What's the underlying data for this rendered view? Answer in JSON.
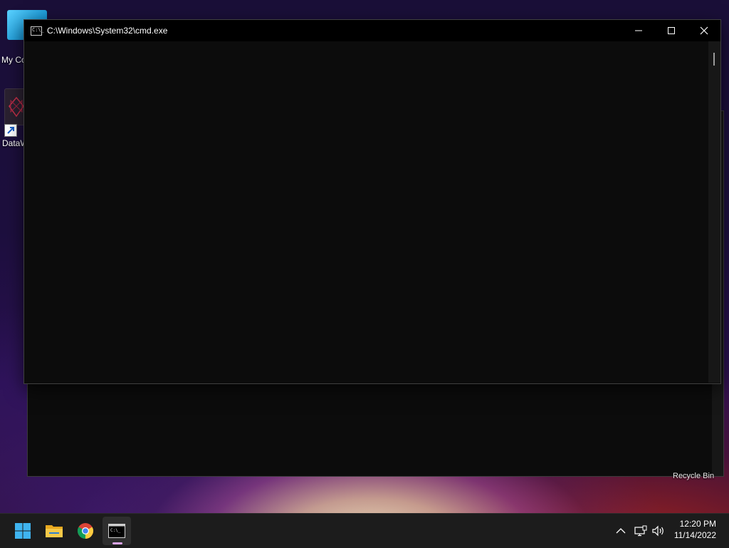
{
  "desktop": {
    "icons": [
      {
        "label": "My Co",
        "icon": "monitor-icon"
      },
      {
        "label": "DataW",
        "icon": "datawarrior-app-icon"
      },
      {
        "label": "Recycle Bin",
        "icon": "recycle-bin-icon"
      }
    ]
  },
  "cmd_window": {
    "title": "C:\\Windows\\System32\\cmd.exe",
    "title_icon_glyph": "C:\\_",
    "buttons": {
      "minimize": "minimize-icon",
      "maximize": "maximize-icon",
      "close": "close-icon"
    },
    "console_text": ""
  },
  "taskbar": {
    "apps": [
      {
        "name": "Start",
        "icon": "windows-start-icon"
      },
      {
        "name": "File Explorer",
        "icon": "folder-icon"
      },
      {
        "name": "Google Chrome",
        "icon": "chrome-icon"
      },
      {
        "name": "Command Prompt",
        "icon": "cmd-icon",
        "active": true
      }
    ],
    "tray": {
      "chevron_icon": "chevron-up-icon",
      "network_icon": "network-icon",
      "volume_icon": "volume-icon"
    },
    "clock": {
      "time": "12:20 PM",
      "date": "11/14/2022"
    }
  },
  "colors": {
    "console_bg": "#0c0c0c",
    "titlebar_bg": "#000000",
    "taskbar_bg": "#1c1c1c",
    "active_indicator": "#d9a3e8"
  }
}
